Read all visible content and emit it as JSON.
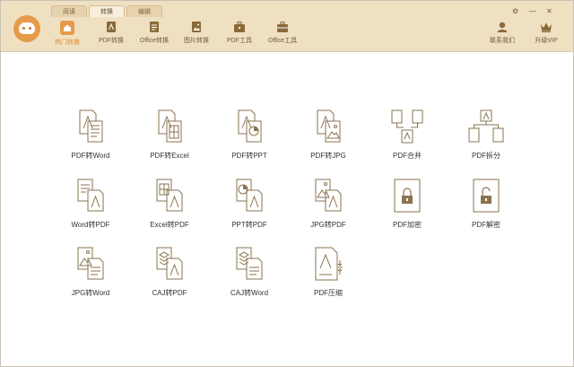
{
  "tabs": [
    {
      "label": "阅读"
    },
    {
      "label": "转换"
    },
    {
      "label": "编辑"
    }
  ],
  "window": {
    "settings": "⚙",
    "minimize": "—",
    "close": "✕"
  },
  "toolbar": [
    {
      "label": "热门转换",
      "icon": "home-icon"
    },
    {
      "label": "PDF转换",
      "icon": "pdf-icon"
    },
    {
      "label": "Office转换",
      "icon": "document-icon"
    },
    {
      "label": "图片转换",
      "icon": "image-icon"
    },
    {
      "label": "PDF工具",
      "icon": "toolbox-icon"
    },
    {
      "label": "Office工具",
      "icon": "toolbox-icon"
    }
  ],
  "right": [
    {
      "label": "联系我们",
      "icon": "user-icon"
    },
    {
      "label": "升级VIP",
      "icon": "crown-icon"
    }
  ],
  "tools": [
    {
      "label": "PDF转Word"
    },
    {
      "label": "PDF转Excel"
    },
    {
      "label": "PDF转PPT"
    },
    {
      "label": "PDF转JPG"
    },
    {
      "label": "PDF合并"
    },
    {
      "label": "PDF拆分"
    },
    {
      "label": "Word转PDF"
    },
    {
      "label": "Excel转PDF"
    },
    {
      "label": "PPT转PDF"
    },
    {
      "label": "JPG转PDF"
    },
    {
      "label": "PDF加密"
    },
    {
      "label": "PDF解密"
    },
    {
      "label": "JPG转Word"
    },
    {
      "label": "CAJ转PDF"
    },
    {
      "label": "CAJ转Word"
    },
    {
      "label": "PDF压缩"
    }
  ],
  "colors": {
    "accent": "#e08a30",
    "header_bg": "#efe0c2",
    "icon_stroke": "#8a7350"
  }
}
